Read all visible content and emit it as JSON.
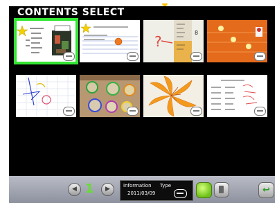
{
  "screen": {
    "title": "CONTENTS SELECT"
  },
  "thumbnails": [
    {
      "name": "handwritten-note-with-photo",
      "selected": true
    },
    {
      "name": "star-note-sheet",
      "selected": false
    },
    {
      "name": "measuring-cylinder-photo",
      "selected": false
    },
    {
      "name": "orange-number-board",
      "selected": false
    },
    {
      "name": "graph-drawing",
      "selected": false
    },
    {
      "name": "colored-circles-photo",
      "selected": false
    },
    {
      "name": "orange-flower-photo",
      "selected": false
    },
    {
      "name": "handwritten-note-red",
      "selected": false
    }
  ],
  "bottombar": {
    "prev_symbol": "◀",
    "page_number": "1",
    "next_symbol": "▶",
    "info_label": "Information",
    "info_date": "2011/03/09",
    "type_label": "Type",
    "return_symbol": "↩"
  },
  "colors": {
    "selected_outline": "#33e633",
    "page_number": "#66dd33"
  }
}
